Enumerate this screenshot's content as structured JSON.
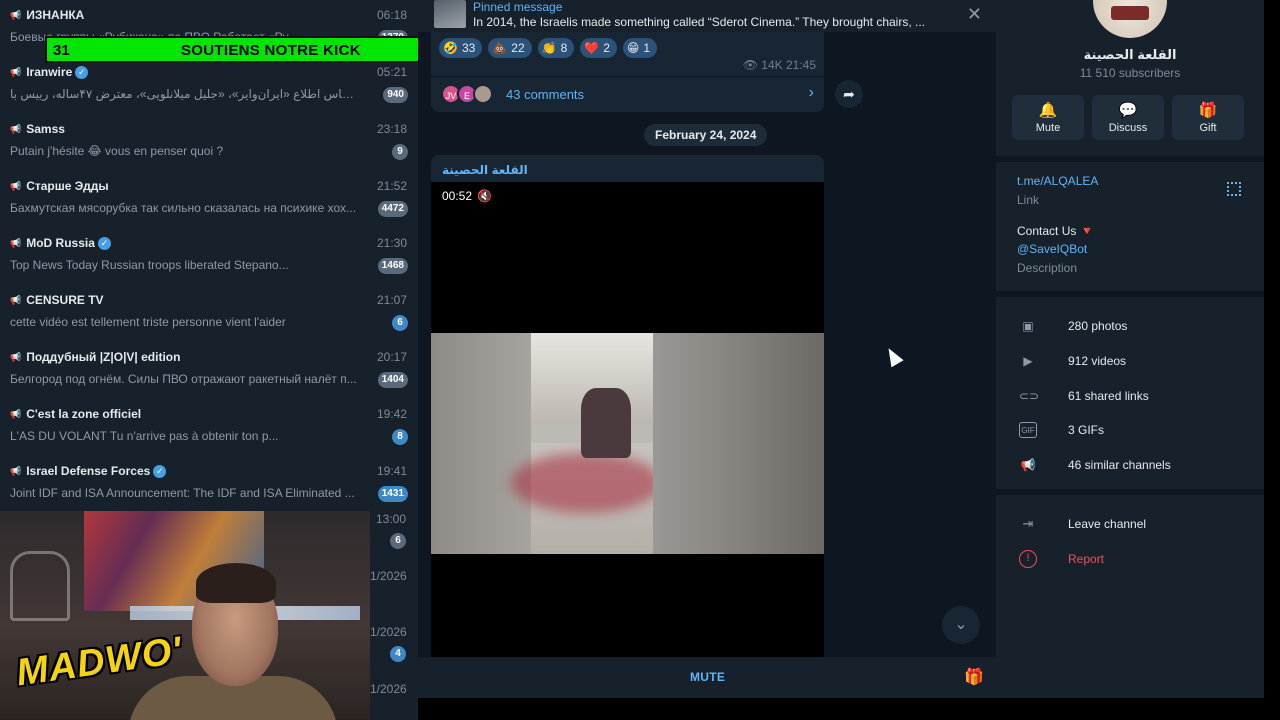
{
  "chatlist": {
    "chats": [
      {
        "title": "ИЗНАНКА",
        "time": "06:18",
        "preview": "Боевые группы «Рубикона» по ПВО  Работает «Ру...",
        "badge": "1370",
        "badge_color": "gray"
      },
      {
        "title": "Iranwire",
        "time": "05:21",
        "preview": "بر اساس اطلاع «ایران‌وایر»، «جلیل میلانلویی»، معترض ۴۷ساله، رییس با...",
        "badge": "940",
        "badge_color": "gray"
      },
      {
        "title": "Samss",
        "time": "23:18",
        "preview": "Putain j'hésite 😂 vous en penser quoi ?",
        "badge": "9",
        "badge_color": "gray"
      },
      {
        "title": "Старше Эдды",
        "time": "21:52",
        "preview": "Бахмутская мясорубка так сильно сказалась на психике хох...",
        "badge": "4472",
        "badge_color": "gray"
      },
      {
        "title": "MoD Russia",
        "time": "21:30",
        "preview": "Top News Today   Russian troops liberated Stepano...",
        "badge": "1468",
        "badge_color": "gray"
      },
      {
        "title": "CENSURE TV",
        "time": "21:07",
        "preview": "cette vidéo est tellement triste personne vient l'aider",
        "badge": "6",
        "badge_color": "blue"
      },
      {
        "title": "Поддубный |Z|O|V| edition",
        "time": "20:17",
        "preview": "Белгород под огнём. Силы ПВО отражают ракетный налёт п...",
        "badge": "1404",
        "badge_color": "gray"
      },
      {
        "title": "C'est la zone officiel",
        "time": "19:42",
        "preview": "L'AS DU VOLANT   Tu n'arrive pas à obtenir ton p...",
        "badge": "8",
        "badge_color": "blue"
      },
      {
        "title": "Israel Defense Forces",
        "time": "19:41",
        "preview": "Joint IDF and ISA Announcement:  The IDF and ISA Eliminated ...",
        "badge": "1431",
        "badge_color": "blue"
      }
    ],
    "partial": [
      {
        "time": "13:00",
        "badge": "6"
      },
      {
        "time": "1/2026",
        "badge": ""
      },
      {
        "time": "1/2026",
        "badge": "4"
      },
      {
        "time": "1/2026",
        "badge": ""
      }
    ]
  },
  "overlay": {
    "kick_count": "31",
    "kick_text": "SOUTIENS NOTRE KICK",
    "streamer_logo": "MADWO'"
  },
  "chat": {
    "pinned_label": "Pinned message",
    "pinned_text": "In 2014, the Israelis made something called “Sderot Cinema.” They brought chairs, ...",
    "reactions": [
      {
        "emoji": "🤣",
        "count": "33"
      },
      {
        "emoji": "💩",
        "count": "22"
      },
      {
        "emoji": "👏",
        "count": "8"
      },
      {
        "emoji": "❤️",
        "count": "2"
      },
      {
        "emoji": "😁",
        "count": "1"
      }
    ],
    "views": "14K",
    "post_time": "21:45",
    "comment_avatars": [
      "JV",
      "E",
      ""
    ],
    "comments": "43 comments",
    "date": "February 24, 2024",
    "author": "القلعة الحصينة",
    "duration": "00:52",
    "mute": "MUTE"
  },
  "info": {
    "name": "القلعة الحصينة",
    "subscribers": "11 510 subscribers",
    "buttons": [
      {
        "label": "Mute",
        "icon": "bell-icon"
      },
      {
        "label": "Discuss",
        "icon": "chat-icon"
      },
      {
        "label": "Gift",
        "icon": "gift-icon"
      }
    ],
    "link": "t.me/ALQALEA",
    "link_label": "Link",
    "contact": "Contact Us 🔻",
    "bot": "@SaveIQBot",
    "description_label": "Description",
    "media": [
      {
        "label": "280 photos",
        "icon": "photo-icon"
      },
      {
        "label": "912 videos",
        "icon": "video-icon"
      },
      {
        "label": "61 shared links",
        "icon": "link-icon"
      },
      {
        "label": "3 GIFs",
        "icon": "gif-icon"
      },
      {
        "label": "46 similar channels",
        "icon": "megaphone-icon"
      }
    ],
    "leave": "Leave channel",
    "report": "Report"
  },
  "colors": {
    "accent": "#5eb5f7",
    "sidebar_bg": "#17212b",
    "chat_bg": "#0e1621",
    "danger": "#e5535d",
    "kick_green": "#00e600"
  }
}
